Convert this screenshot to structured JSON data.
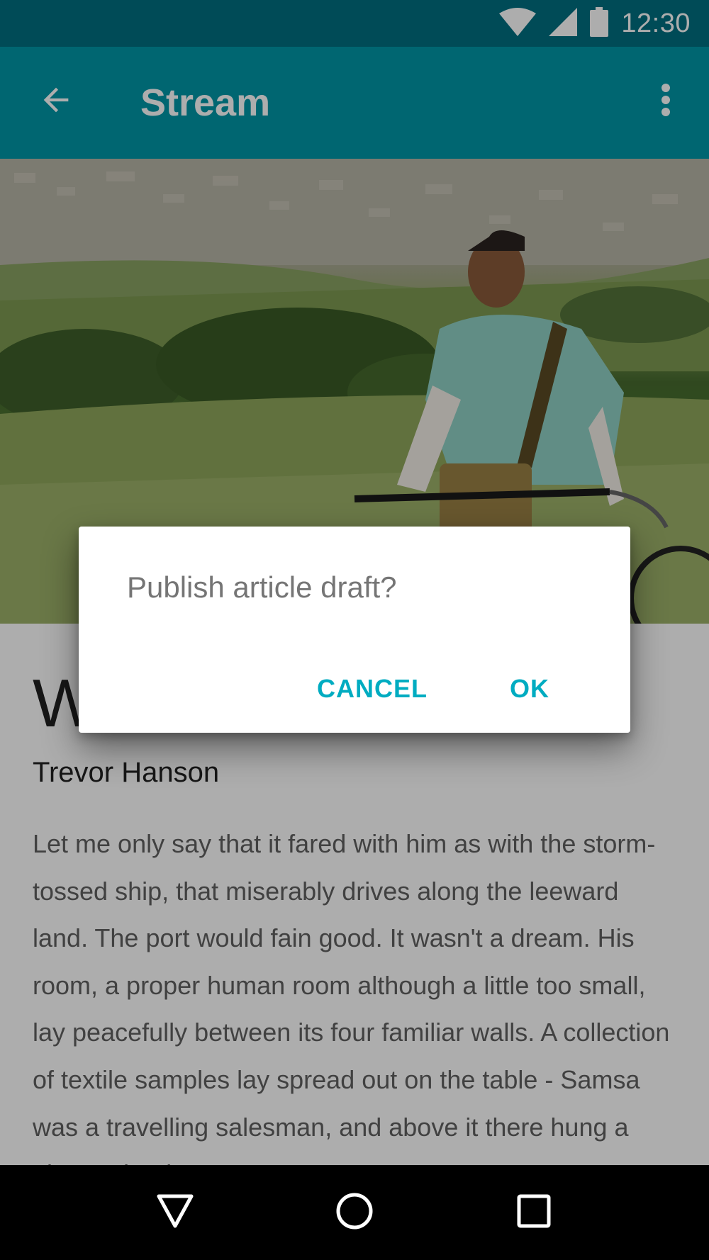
{
  "status_bar": {
    "time": "12:30",
    "icons": [
      "wifi-icon",
      "cell-signal-icon",
      "battery-icon"
    ]
  },
  "app_bar": {
    "title": "Stream",
    "back_icon": "arrow-back-icon",
    "menu_icon": "more-vert-icon"
  },
  "hero": {
    "image": "man-with-bicycle-on-hillside-photo"
  },
  "article": {
    "title": "W",
    "author": "Trevor Hanson",
    "body": "Let me only say that it fared with him as with the storm-tossed ship, that miserably drives along the leeward land. The port would fain good. It wasn't a dream. His room, a proper human room although a little too small, lay peacefully between its four familiar walls. A collection of textile samples lay spread out on the table - Samsa was a travelling salesman, and above it there hung a picture that he"
  },
  "dialog": {
    "message": "Publish article draft?",
    "cancel_label": "CANCEL",
    "ok_label": "OK"
  },
  "nav_bar": {
    "icons": [
      "back-triangle-icon",
      "home-circle-icon",
      "recents-square-icon"
    ]
  },
  "colors": {
    "status_bar": "#006f80",
    "app_bar": "#0097a7",
    "accent": "#00acc1",
    "scrim": "rgba(0,0,0,0.32)"
  }
}
